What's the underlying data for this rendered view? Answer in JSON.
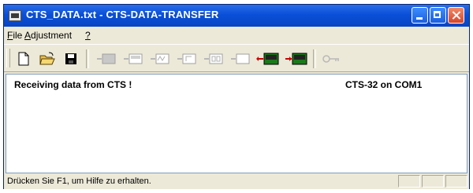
{
  "window": {
    "title": "CTS_DATA.txt - CTS-DATA-TRANSFER"
  },
  "menu": {
    "file": {
      "mnemonic": "F",
      "rest": "ile"
    },
    "adjustment": {
      "mnemonic": "A",
      "rest": "djustment"
    },
    "help": {
      "mnemonic": "?"
    }
  },
  "toolbar": {
    "buttons": [
      {
        "icon": "new-document-icon",
        "enabled": true
      },
      {
        "icon": "open-folder-icon",
        "enabled": true
      },
      {
        "icon": "save-disk-icon",
        "enabled": true
      },
      {
        "icon": "device-transfer-icon-1",
        "enabled": false
      },
      {
        "icon": "device-transfer-icon-2",
        "enabled": false
      },
      {
        "icon": "device-transfer-icon-3",
        "enabled": false
      },
      {
        "icon": "device-transfer-icon-4",
        "enabled": false
      },
      {
        "icon": "device-transfer-icon-5",
        "enabled": false
      },
      {
        "icon": "device-transfer-icon-6",
        "enabled": false
      },
      {
        "icon": "device-receive-icon",
        "enabled": true
      },
      {
        "icon": "device-send-icon",
        "enabled": true
      },
      {
        "icon": "key-icon",
        "enabled": false
      }
    ]
  },
  "content": {
    "status_message": "Receiving data from CTS !",
    "device_info": "CTS-32 on COM1"
  },
  "statusbar": {
    "help_text": "Drücken Sie F1, um Hilfe zu erhalten."
  },
  "colors": {
    "title_bar": "#0a4fd8",
    "window_face": "#ECE9D8",
    "close_button": "#d6452a",
    "arrow_red": "#cc0000",
    "device_green": "#1a7a1a"
  }
}
